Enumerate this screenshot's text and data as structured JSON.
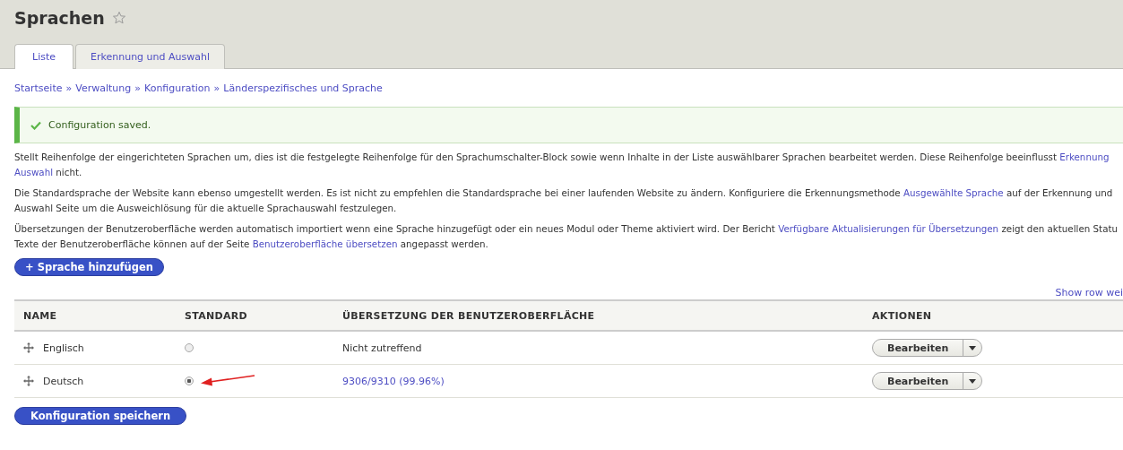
{
  "page_title": "Sprachen",
  "tabs": [
    {
      "label": "Liste",
      "selected": true
    },
    {
      "label": "Erkennung und Auswahl",
      "selected": false
    }
  ],
  "breadcrumb": [
    "Startseite",
    "Verwaltung",
    "Konfiguration",
    "Länderspezifisches und Sprache"
  ],
  "breadcrumb_separator": "»",
  "message": {
    "kind": "status",
    "text": "Configuration saved."
  },
  "paragraphs": [
    [
      [
        {
          "kind": "text",
          "text": "Stellt Reihenfolge der eingerichteten Sprachen um, dies ist die festgelegte Reihenfolge für den Sprachumschalter-Block sowie wenn Inhalte in der Liste auswählbarer Sprachen bearbeitet werden. Diese Reihenfolge beeinflusst "
        },
        {
          "kind": "link",
          "text": "Erkennung"
        }
      ],
      [
        {
          "kind": "link",
          "text": "Auswahl"
        },
        {
          "kind": "text",
          "text": " nicht."
        }
      ]
    ],
    [
      [
        {
          "kind": "text",
          "text": "Die Standardsprache der Website kann ebenso umgestellt werden. Es ist nicht zu empfehlen die Standardsprache bei einer laufenden Website zu ändern. Konfiguriere die Erkennungsmethode "
        },
        {
          "kind": "link",
          "text": "Ausgewählte Sprache"
        },
        {
          "kind": "text",
          "text": " auf der Erkennung und"
        }
      ],
      [
        {
          "kind": "text",
          "text": "Auswahl Seite um die Ausweichlösung für die aktuelle Sprachauswahl festzulegen."
        }
      ]
    ],
    [
      [
        {
          "kind": "text",
          "text": "Übersetzungen der Benutzeroberfläche werden automatisch importiert wenn eine Sprache hinzugefügt oder ein neues Modul oder Theme aktiviert wird. Der Bericht "
        },
        {
          "kind": "link",
          "text": "Verfügbare Aktualisierungen für Übersetzungen"
        },
        {
          "kind": "text",
          "text": " zeigt den aktuellen Statu"
        }
      ],
      [
        {
          "kind": "text",
          "text": "Texte der Benutzeroberfläche können auf der Seite "
        },
        {
          "kind": "link",
          "text": "Benutzeroberfläche übersetzen"
        },
        {
          "kind": "text",
          "text": " angepasst werden."
        }
      ]
    ]
  ],
  "add_button": "+ Sprache hinzufügen",
  "row_weights_link": "Show row wei",
  "table": {
    "columns": [
      "NAME",
      "STANDARD",
      "ÜBERSETZUNG DER BENUTZEROBERFLÄCHE",
      "AKTIONEN"
    ],
    "rows": [
      {
        "name": "Englisch",
        "selected": false,
        "translation": "Nicht zutreffend",
        "translation_link": false,
        "action": "Bearbeiten"
      },
      {
        "name": "Deutsch",
        "selected": true,
        "translation": "9306/9310 (99.96%)",
        "translation_link": true,
        "action": "Bearbeiten"
      }
    ]
  },
  "save_button": "Konfiguration speichern"
}
